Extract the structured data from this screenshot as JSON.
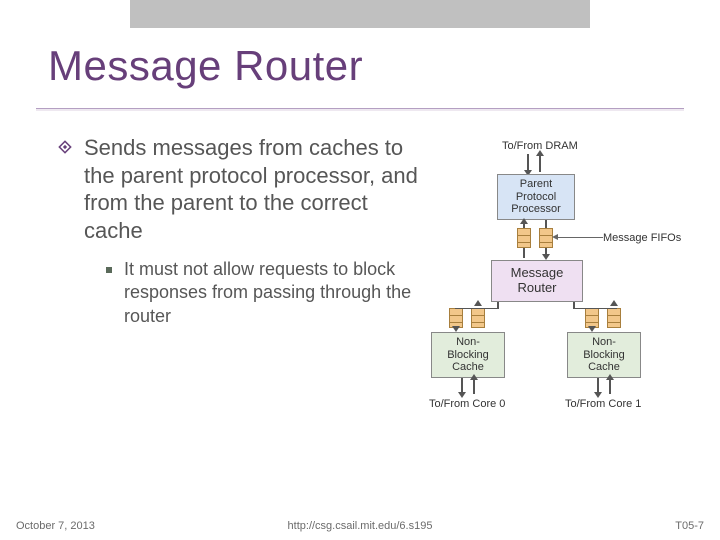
{
  "title": "Message Router",
  "bullets": {
    "main": "Sends messages from caches to the parent protocol processor, and from the parent to the correct cache",
    "sub": "It must not allow requests to block responses from passing through the router"
  },
  "diagram": {
    "dram_label": "To/From DRAM",
    "ppp": "Parent\nProtocol\nProcessor",
    "fifo_label": "Message FIFOs",
    "router": "Message\nRouter",
    "cache0": "Non-\nBlocking\nCache",
    "cache1": "Non-\nBlocking\nCache",
    "core0": "To/From Core 0",
    "core1": "To/From Core 1"
  },
  "footer": {
    "date": "October 7, 2013",
    "url": "http://csg.csail.mit.edu/6.s195",
    "pageno": "T05-7"
  }
}
